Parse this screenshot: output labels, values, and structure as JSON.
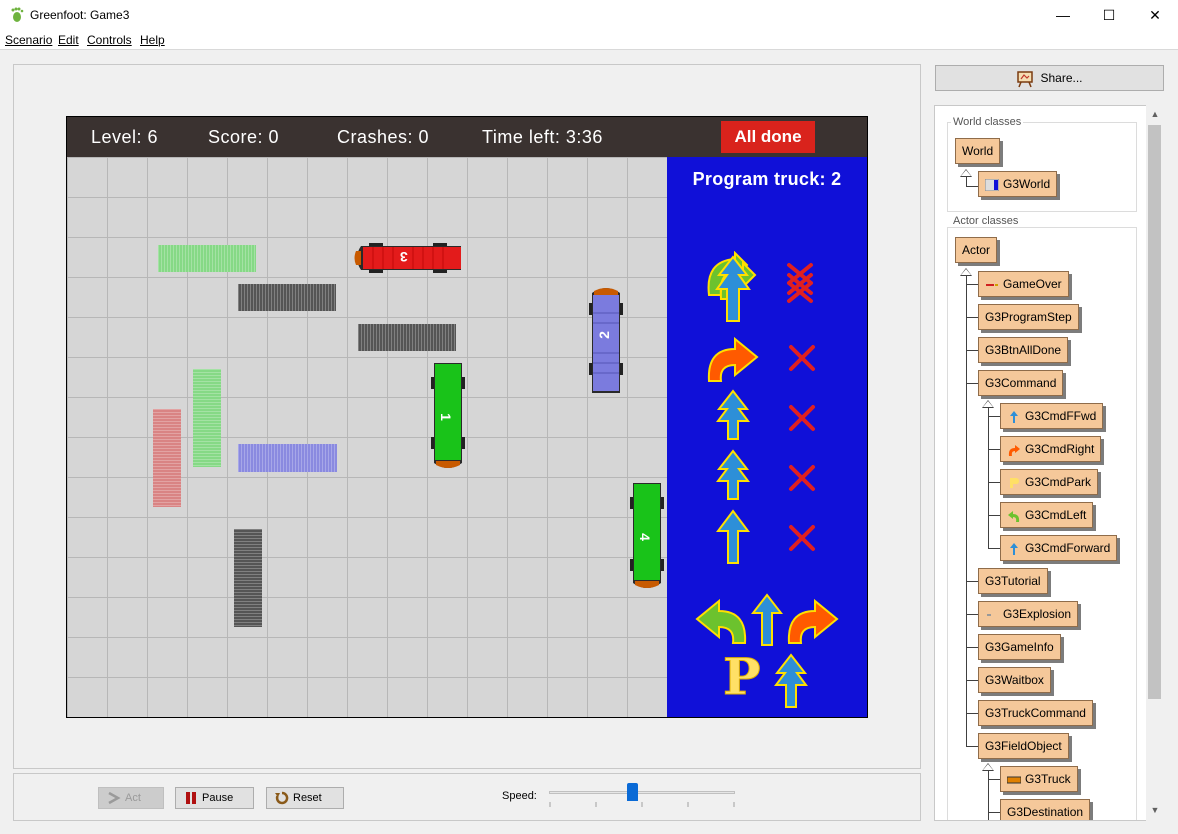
{
  "window": {
    "title": "Greenfoot: Game3",
    "minimize": "—",
    "maximize": "☐",
    "close": "✕"
  },
  "menu": [
    "Scenario",
    "Edit",
    "Controls",
    "Help"
  ],
  "world": {
    "level": "Level: 6",
    "score": "Score: 0",
    "crashes": "Crashes: 0",
    "time_left": "Time left: 3:36",
    "all_done": "All done",
    "program_truck": "Program truck: 2",
    "trucks": [
      {
        "number": "1",
        "color": "#19c319"
      },
      {
        "number": "2",
        "color": "#7b7bde"
      },
      {
        "number": "3",
        "color": "#e31b1b"
      },
      {
        "number": "4",
        "color": "#19c319"
      }
    ],
    "program_steps": [
      "fast-forward",
      "turn-right",
      "forward-twice",
      "forward-twice",
      "forward"
    ],
    "command_palette": [
      "turn-left",
      "forward",
      "turn-right",
      "park",
      "fast-forward"
    ],
    "park_letter": "P"
  },
  "controls": {
    "act": "Act",
    "pause": "Pause",
    "reset": "Reset",
    "speed_label": "Speed:",
    "speed_fraction": 0.45
  },
  "right_pane": {
    "share": "Share...",
    "world_classes_label": "World classes",
    "actor_classes_label": "Actor classes",
    "world_classes": [
      "World",
      "G3World"
    ],
    "actor_classes": [
      "Actor",
      "GameOver",
      "G3ProgramStep",
      "G3BtnAllDone",
      "G3Command",
      "G3CmdFFwd",
      "G3CmdRight",
      "G3CmdPark",
      "G3CmdLeft",
      "G3CmdForward",
      "G3Tutorial",
      "G3Explosion",
      "G3GameInfo",
      "G3Waitbox",
      "G3TruckCommand",
      "G3FieldObject",
      "G3Truck",
      "G3Destination"
    ]
  },
  "colors": {
    "panel_blue": "#1010d8",
    "all_done_red": "#d9231c",
    "class_fill": "#f5c89a"
  }
}
